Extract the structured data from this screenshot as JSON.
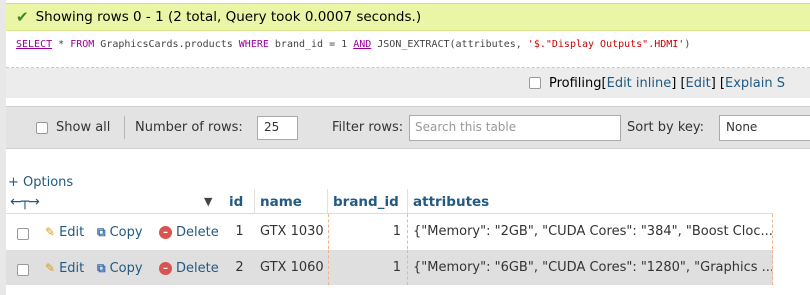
{
  "message": {
    "text": "Showing rows 0 - 1 (2 total, Query took 0.0007 seconds.)"
  },
  "sql": {
    "select": "SELECT",
    "p1": " * ",
    "from": "FROM",
    "table": " GraphicsCards.products ",
    "where": "WHERE",
    "cond1": " brand_id = 1 ",
    "and": "AND",
    "func": " JSON_EXTRACT(attributes, ",
    "path": "'$.\"Display Outputs\".HDMI'",
    "close": ")"
  },
  "profiling": {
    "label": "Profiling",
    "open_bracket": " [ ",
    "edit_inline": "Edit inline",
    "mid1": " ] [ ",
    "edit": "Edit",
    "mid2": " ] [ ",
    "explain": "Explain S"
  },
  "nav": {
    "show_all": "Show all",
    "number_of_rows_label": "Number of rows:",
    "number_of_rows_value": "25",
    "filter_rows_label": "Filter rows:",
    "filter_placeholder": "Search this table",
    "sort_key_label": "Sort by key:",
    "sort_key_value": "None"
  },
  "options_link": "+ Options",
  "columns": [
    "id",
    "name",
    "brand_id",
    "attributes"
  ],
  "actions": {
    "edit": "Edit",
    "copy": "Copy",
    "delete": "Delete"
  },
  "rows": [
    {
      "id": "1",
      "name": "GTX 1030",
      "brand_id": "1",
      "attributes": "{\"Memory\": \"2GB\", \"CUDA Cores\": \"384\", \"Boost Cloc..."
    },
    {
      "id": "2",
      "name": "GTX 1060",
      "brand_id": "1",
      "attributes": "{\"Memory\": \"6GB\", \"CUDA Cores\": \"1280\", \"Graphics ..."
    }
  ],
  "colors": {
    "success_bg": "#ebf5a6",
    "link": "#235a81",
    "keyword": "#990099",
    "string": "#cc0000"
  }
}
